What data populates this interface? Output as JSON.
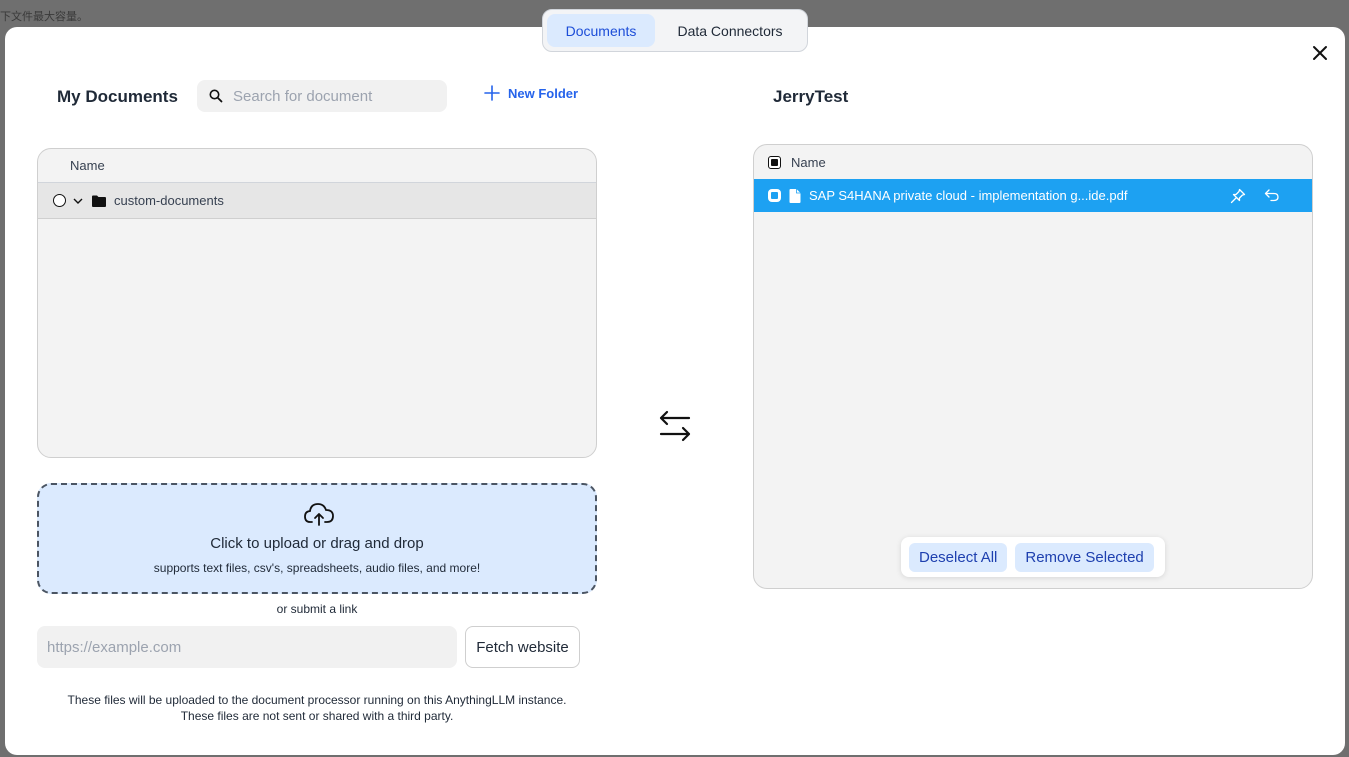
{
  "background": {
    "text": "下文件最大容量。"
  },
  "tabs": [
    {
      "label": "Documents",
      "active": true
    },
    {
      "label": "Data Connectors",
      "active": false
    }
  ],
  "left": {
    "title": "My Documents",
    "search_placeholder": "Search for document",
    "new_folder_label": "New Folder",
    "table": {
      "header": "Name",
      "rows": [
        {
          "name": "custom-documents",
          "type": "folder",
          "expanded": false,
          "checked": false
        }
      ]
    },
    "upload": {
      "main": "Click to upload or drag and drop",
      "sub": "supports text files, csv's, spreadsheets, audio files, and more!"
    },
    "link_label": "or submit a link",
    "url_placeholder": "https://example.com",
    "fetch_label": "Fetch website",
    "footnote_line1": "These files will be uploaded to the document processor running on this AnythingLLM instance.",
    "footnote_line2": "These files are not sent or shared with a third party."
  },
  "right": {
    "title": "JerryTest",
    "table": {
      "header": "Name",
      "rows": [
        {
          "name": "SAP S4HANA private cloud - implementation g...ide.pdf",
          "type": "file",
          "selected": true
        }
      ]
    },
    "deselect_label": "Deselect All",
    "remove_label": "Remove Selected"
  },
  "colors": {
    "accent": "#2563eb",
    "selected_row": "#1da1f2",
    "tab_active_bg": "#dbeafe",
    "upload_bg": "#dbeafe"
  },
  "icons": [
    "search-icon",
    "plus-icon",
    "close-icon",
    "chevron-down-icon",
    "folder-icon",
    "file-icon",
    "pin-icon",
    "undo-icon",
    "swap-arrows-icon",
    "cloud-upload-icon"
  ]
}
